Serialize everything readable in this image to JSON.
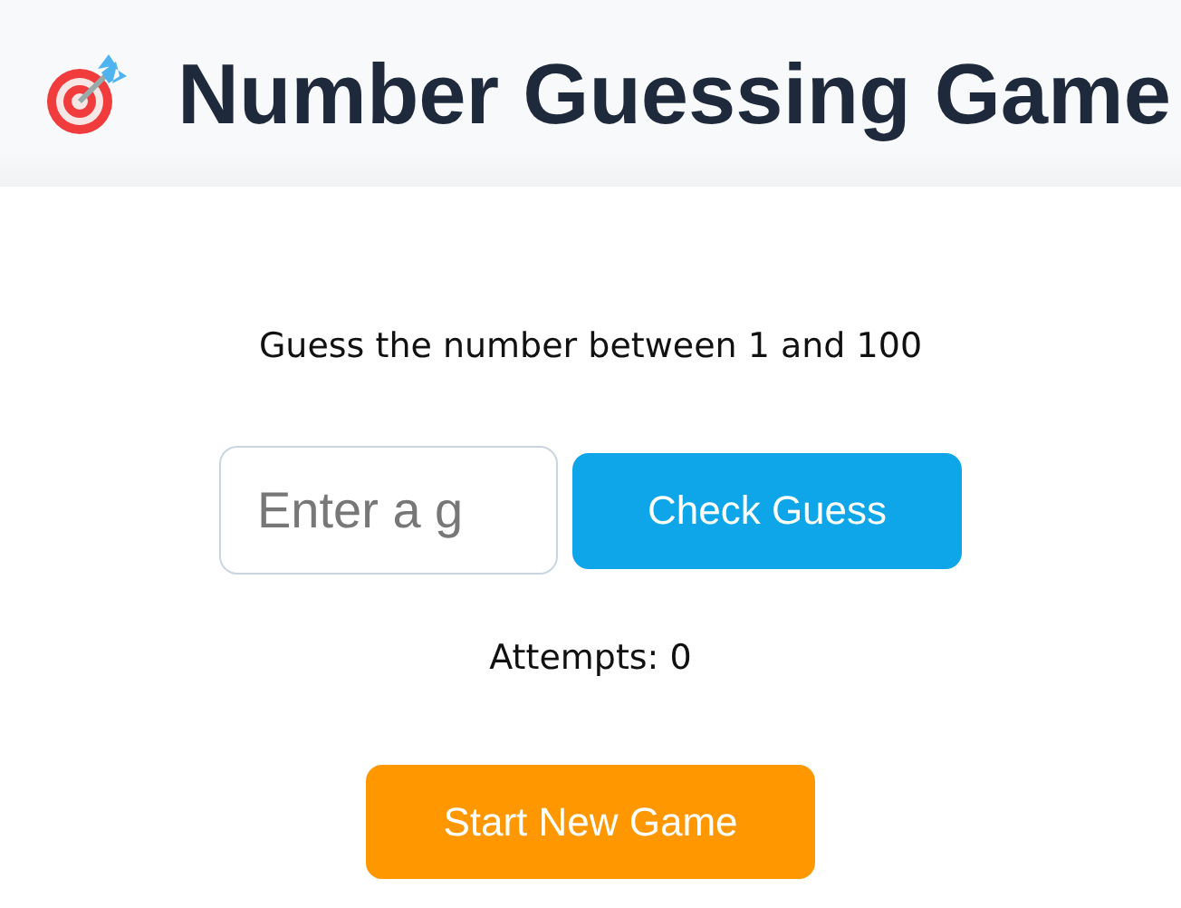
{
  "header": {
    "title": "Number Guessing Game"
  },
  "prompt": "Guess the number between 1 and 100",
  "guess_field": {
    "placeholder": "Enter a g"
  },
  "check_button": "Check Guess",
  "attempts": "Attempts: 0",
  "new_game_button": "Start New Game"
}
